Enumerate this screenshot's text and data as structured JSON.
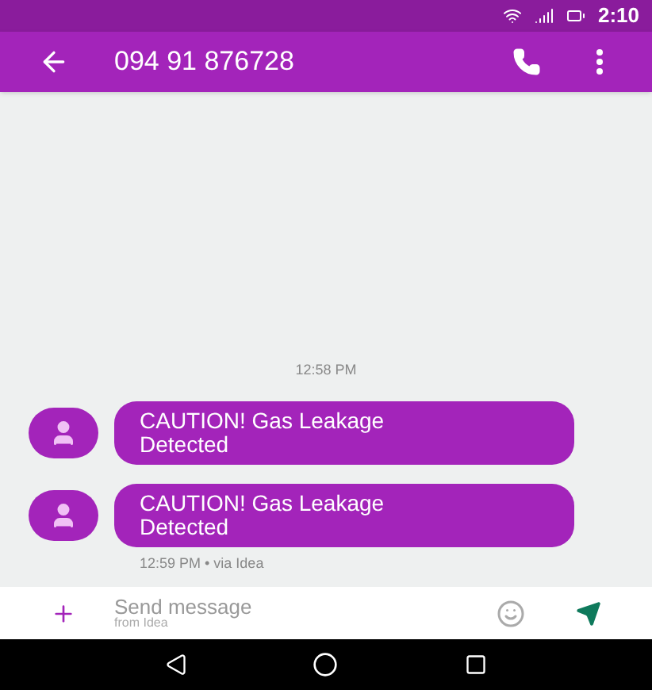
{
  "status_bar": {
    "time": "2:10"
  },
  "app_bar": {
    "title": "094 91 876728"
  },
  "conversation": {
    "timestamp": "12:58 PM",
    "messages": [
      {
        "text": "CAUTION! Gas Leakage Detected"
      },
      {
        "text": "CAUTION! Gas Leakage Detected"
      }
    ],
    "footer": "12:59 PM • via Idea"
  },
  "compose": {
    "placeholder": "Send message",
    "subtitle": "from Idea"
  }
}
